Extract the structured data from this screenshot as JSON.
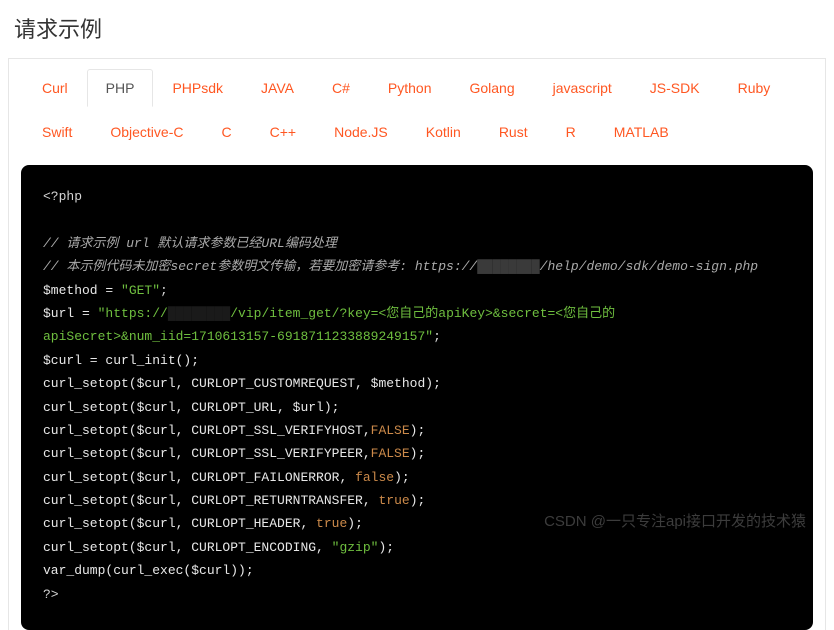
{
  "title": "请求示例",
  "tabs": {
    "row": [
      "Curl",
      "PHP",
      "PHPsdk",
      "JAVA",
      "C#",
      "Python",
      "Golang",
      "javascript",
      "JS-SDK",
      "Ruby",
      "Swift",
      "Objective-C",
      "C",
      "C++",
      "Node.JS",
      "Kotlin",
      "Rust",
      "R",
      "MATLAB"
    ],
    "active": "PHP"
  },
  "code": {
    "open": "<?php",
    "comment1": "// 请求示例 url 默认请求参数已经URL编码处理",
    "comment2": "// 本示例代码未加密secret参数明文传输，若要加密请参考: https://",
    "comment2b": "/help/demo/sdk/demo-sign.php",
    "method_lhs": "$method = ",
    "method_val": "\"GET\"",
    "semi": ";",
    "url_lhs": "$url = ",
    "url_val_a": "\"https://",
    "url_val_b": "/vip/item_get/?key=<您自己的apiKey>&secret=<您自己的apiSecret>&num_iid=1710613157-6918711233889249157\"",
    "curl_init": "$curl = curl_init();",
    "l1": "curl_setopt($curl, CURLOPT_CUSTOMREQUEST, $method);",
    "l2": "curl_setopt($curl, CURLOPT_URL, $url);",
    "l3a": "curl_setopt($curl, CURLOPT_SSL_VERIFYHOST,",
    "l3b": "FALSE",
    "l3c": ");",
    "l4a": "curl_setopt($curl, CURLOPT_SSL_VERIFYPEER,",
    "l4b": "FALSE",
    "l4c": ");",
    "l5a": "curl_setopt($curl, CURLOPT_FAILONERROR, ",
    "l5b": "false",
    "l5c": ");",
    "l6a": "curl_setopt($curl, CURLOPT_RETURNTRANSFER, ",
    "l6b": "true",
    "l6c": ");",
    "l7a": "curl_setopt($curl, CURLOPT_HEADER, ",
    "l7b": "true",
    "l7c": ");",
    "l8a": "curl_setopt($curl, CURLOPT_ENCODING, ",
    "l8b": "\"gzip\"",
    "l8c": ");",
    "l9": "var_dump(curl_exec($curl));",
    "close": "?>"
  },
  "watermark": "CSDN @一只专注api接口开发的技术猿"
}
